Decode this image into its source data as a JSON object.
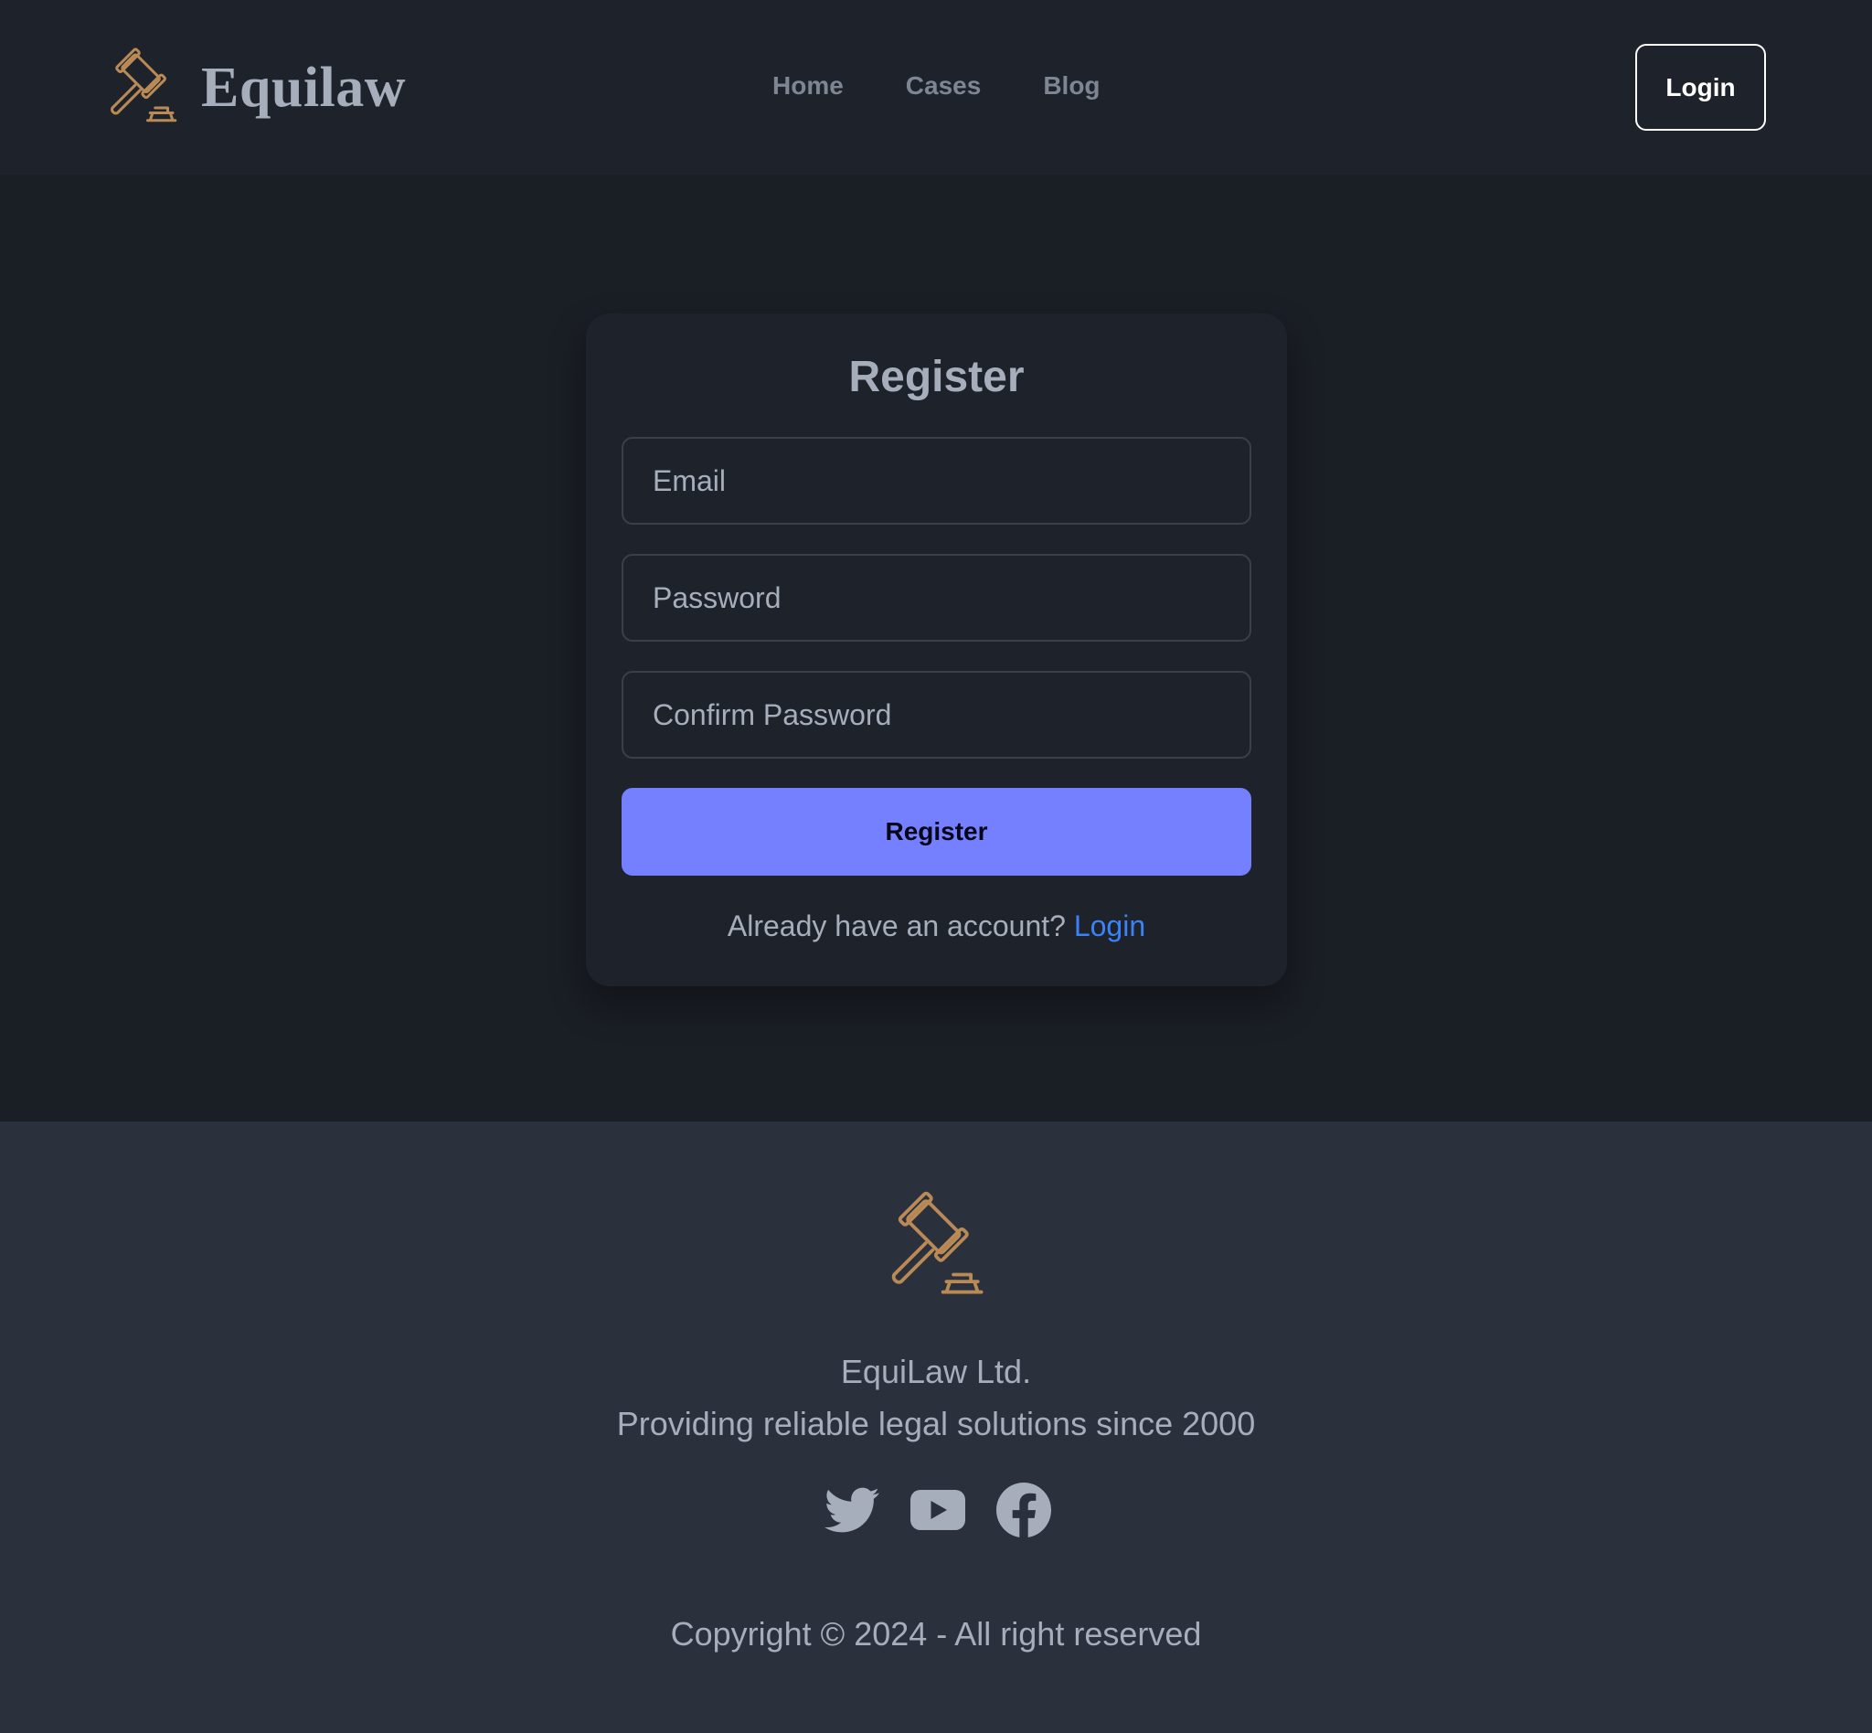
{
  "header": {
    "brand_name": "Equilaw",
    "logo_icon": "gavel-icon",
    "nav": [
      {
        "label": "Home"
      },
      {
        "label": "Cases"
      },
      {
        "label": "Blog"
      }
    ],
    "login_label": "Login"
  },
  "register": {
    "title": "Register",
    "email_placeholder": "Email",
    "email_value": "",
    "password_placeholder": "Password",
    "password_value": "",
    "confirm_placeholder": "Confirm Password",
    "confirm_value": "",
    "submit_label": "Register",
    "already_text": "Already have an account?",
    "login_link": "Login"
  },
  "footer": {
    "logo_icon": "gavel-icon",
    "company": "EquiLaw Ltd.",
    "tagline": "Providing reliable legal solutions since 2000",
    "socials": [
      "twitter-icon",
      "youtube-icon",
      "facebook-icon"
    ],
    "copyright": "Copyright © 2024 - All right reserved"
  },
  "colors": {
    "page_bg": "#1a1e25",
    "header_bg": "#1e232b",
    "footer_bg": "#2a313c",
    "primary": "#7480ff",
    "link": "#3b82f6",
    "logo_gold": "#b98a55",
    "text": "#a6adbb"
  }
}
